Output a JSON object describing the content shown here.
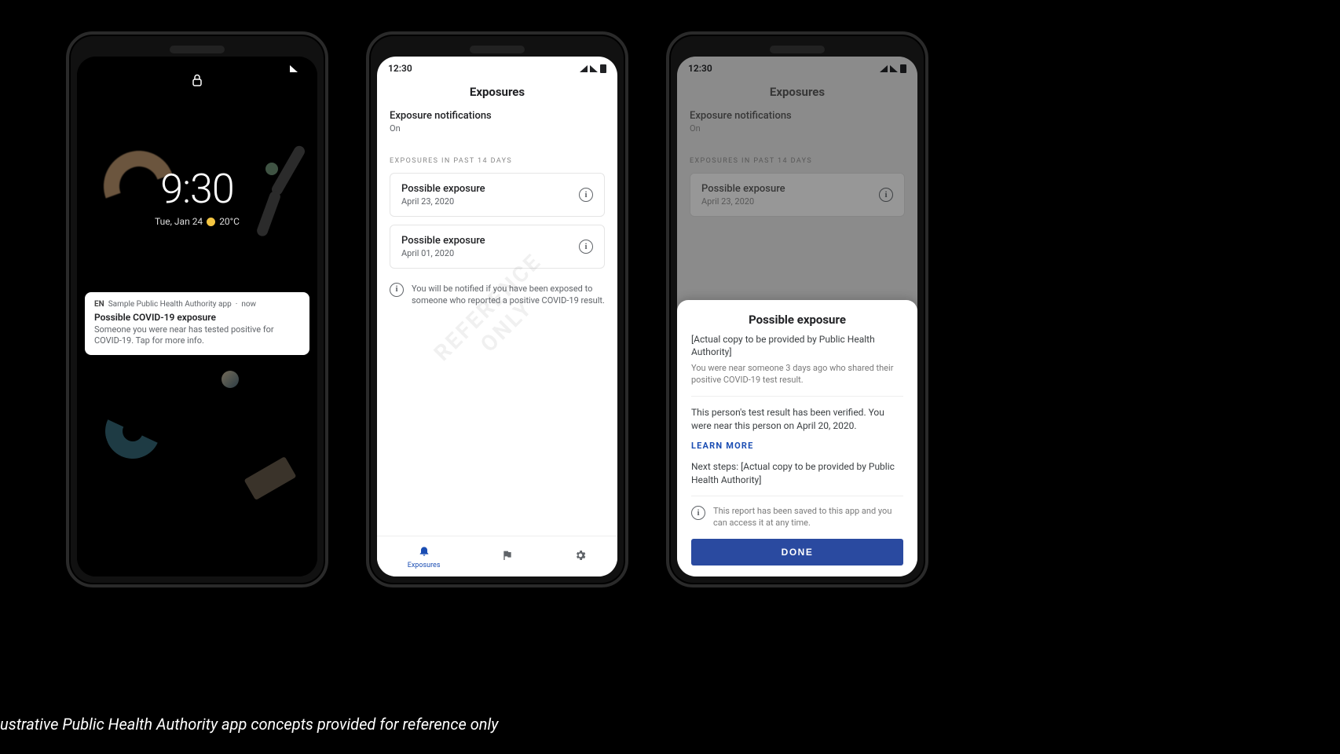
{
  "stage_caption": "ustrative Public Health Authority app concepts provided for reference only",
  "status_time": "12:30",
  "lockscreen": {
    "big_time": "9:30",
    "date": "Tue, Jan 24",
    "temp": "20°C",
    "notif_source_prefix": "EN",
    "notif_source": "Sample Public Health Authority app",
    "notif_when": "now",
    "notif_title": "Possible COVID-19 exposure",
    "notif_body": "Someone you were near has tested positive for COVID-19. Tap for more info."
  },
  "exposures": {
    "page_title": "Exposures",
    "settings_label": "Exposure notifications",
    "settings_value": "On",
    "list_caption": "EXPOSURES IN PAST 14 DAYS",
    "items": [
      {
        "title": "Possible exposure",
        "date": "April 23, 2020"
      },
      {
        "title": "Possible exposure",
        "date": "April 01, 2020"
      }
    ],
    "footnote": "You will be notified if you have been exposed to someone who reported a positive COVID-19 result.",
    "watermark": "REFERENCE ONLY",
    "nav": {
      "tab1": "Exposures",
      "tab2": "",
      "tab3": ""
    }
  },
  "sheet": {
    "title": "Possible exposure",
    "subtitle": "[Actual copy to be provided by Public Health Authority]",
    "summary": "You were near someone 3 days ago who shared their positive COVID-19 test result.",
    "body": "This person's test result has been verified. You were near this person on April 20, 2020.",
    "learn_more": "LEARN MORE",
    "next_steps": "Next steps: [Actual copy to be provided by Public Health Authority]",
    "saved_note": "This report has been saved to this app and you can access it at any time.",
    "done": "DONE"
  }
}
